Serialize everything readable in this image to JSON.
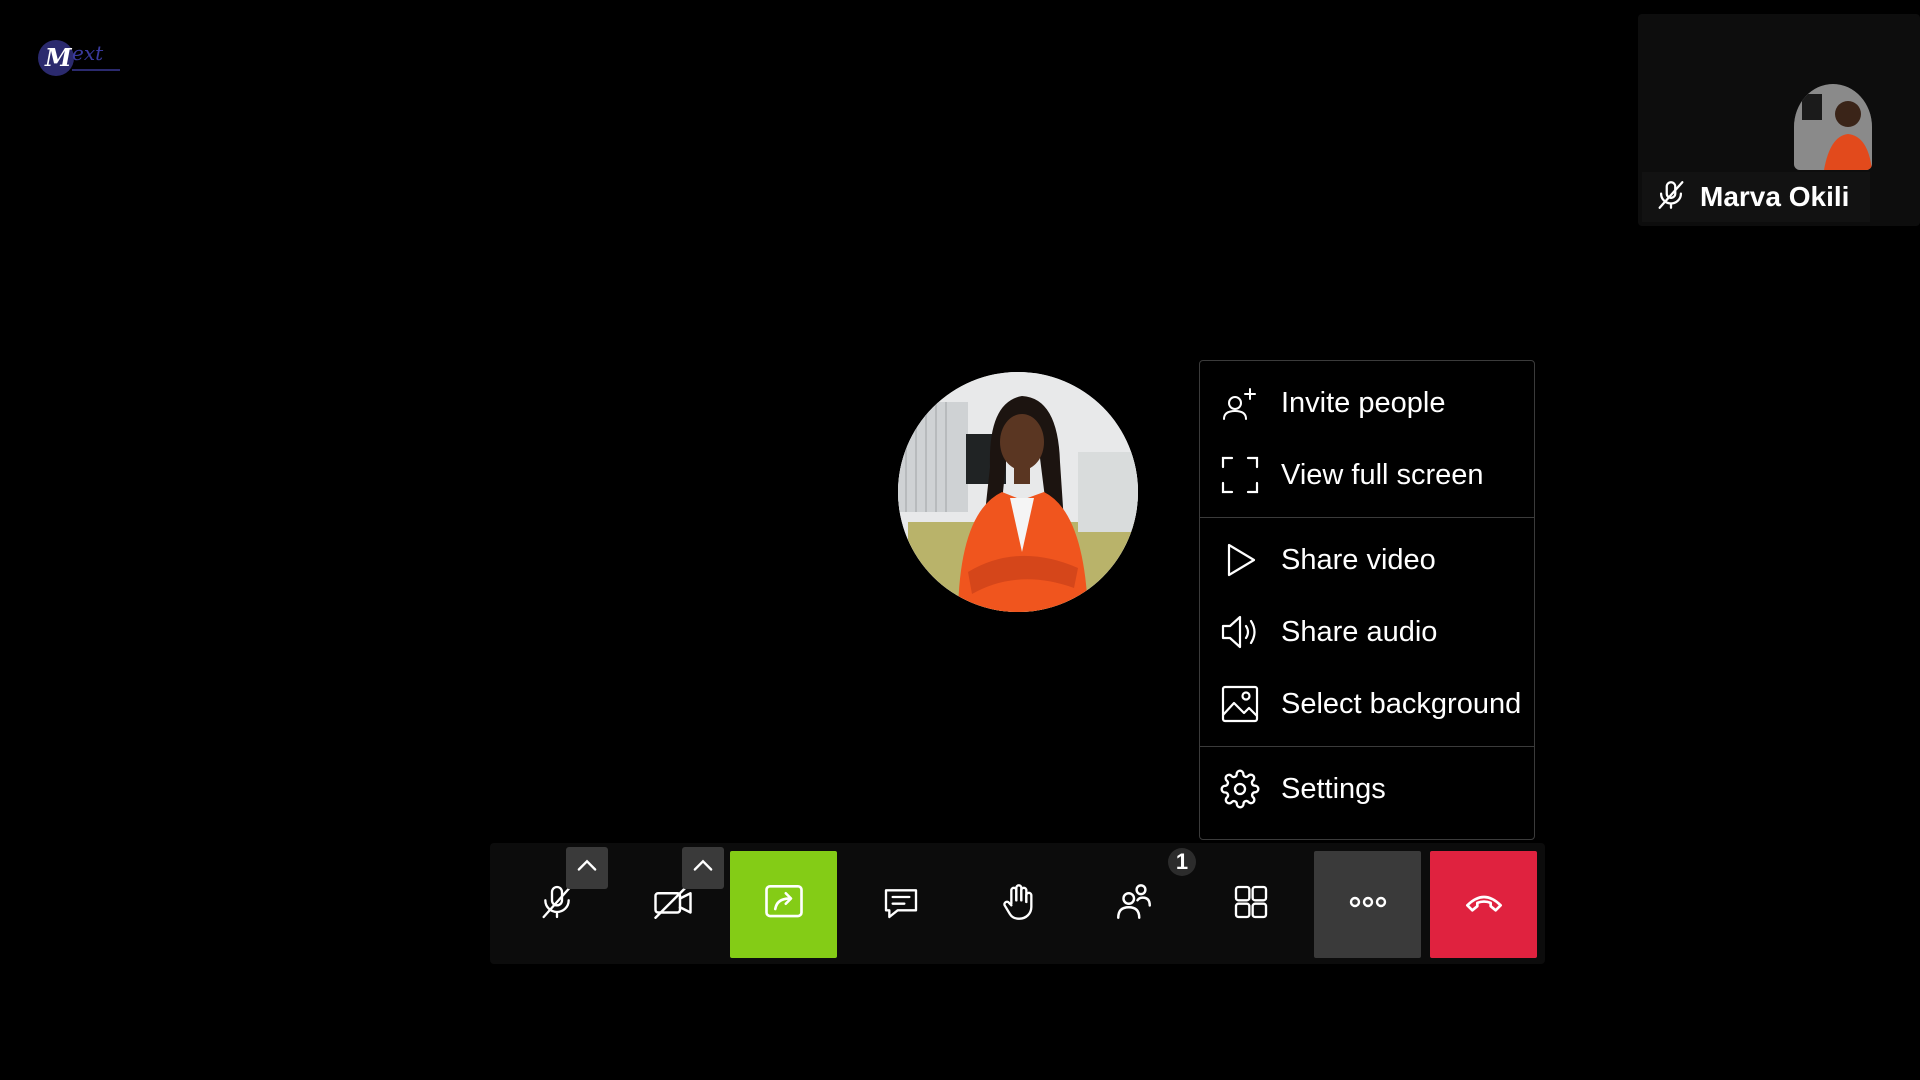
{
  "branding": {
    "logo_text": "Mext"
  },
  "self_tile": {
    "name": "Marva Okili",
    "mic_state": "muted"
  },
  "main_participant": {
    "avatar": "participant-photo"
  },
  "more_menu": {
    "groups": [
      [
        {
          "label": "Invite people",
          "icon": "invite-people-icon"
        },
        {
          "label": "View full screen",
          "icon": "fullscreen-icon"
        }
      ],
      [
        {
          "label": "Share video",
          "icon": "play-icon"
        },
        {
          "label": "Share audio",
          "icon": "speaker-icon"
        },
        {
          "label": "Select background",
          "icon": "image-icon"
        }
      ],
      [
        {
          "label": "Settings",
          "icon": "gear-icon"
        }
      ]
    ]
  },
  "toolbar": {
    "participants_count": "1",
    "buttons": [
      {
        "name": "microphone",
        "icon": "mic-off-icon",
        "state": "muted"
      },
      {
        "name": "camera",
        "icon": "camera-off-icon",
        "state": "off"
      },
      {
        "name": "screen-share",
        "icon": "screen-share-icon",
        "state": "active"
      },
      {
        "name": "chat",
        "icon": "chat-icon"
      },
      {
        "name": "raise-hand",
        "icon": "hand-icon"
      },
      {
        "name": "participants",
        "icon": "participants-icon"
      },
      {
        "name": "tile-view",
        "icon": "grid-icon"
      },
      {
        "name": "more",
        "icon": "more-icon",
        "state": "open"
      },
      {
        "name": "hang-up",
        "icon": "phone-hangup-icon"
      }
    ]
  },
  "colors": {
    "background": "#000000",
    "share_active": "#84cc16",
    "hangup": "#e0223f",
    "more_active": "#3a3a3a"
  }
}
